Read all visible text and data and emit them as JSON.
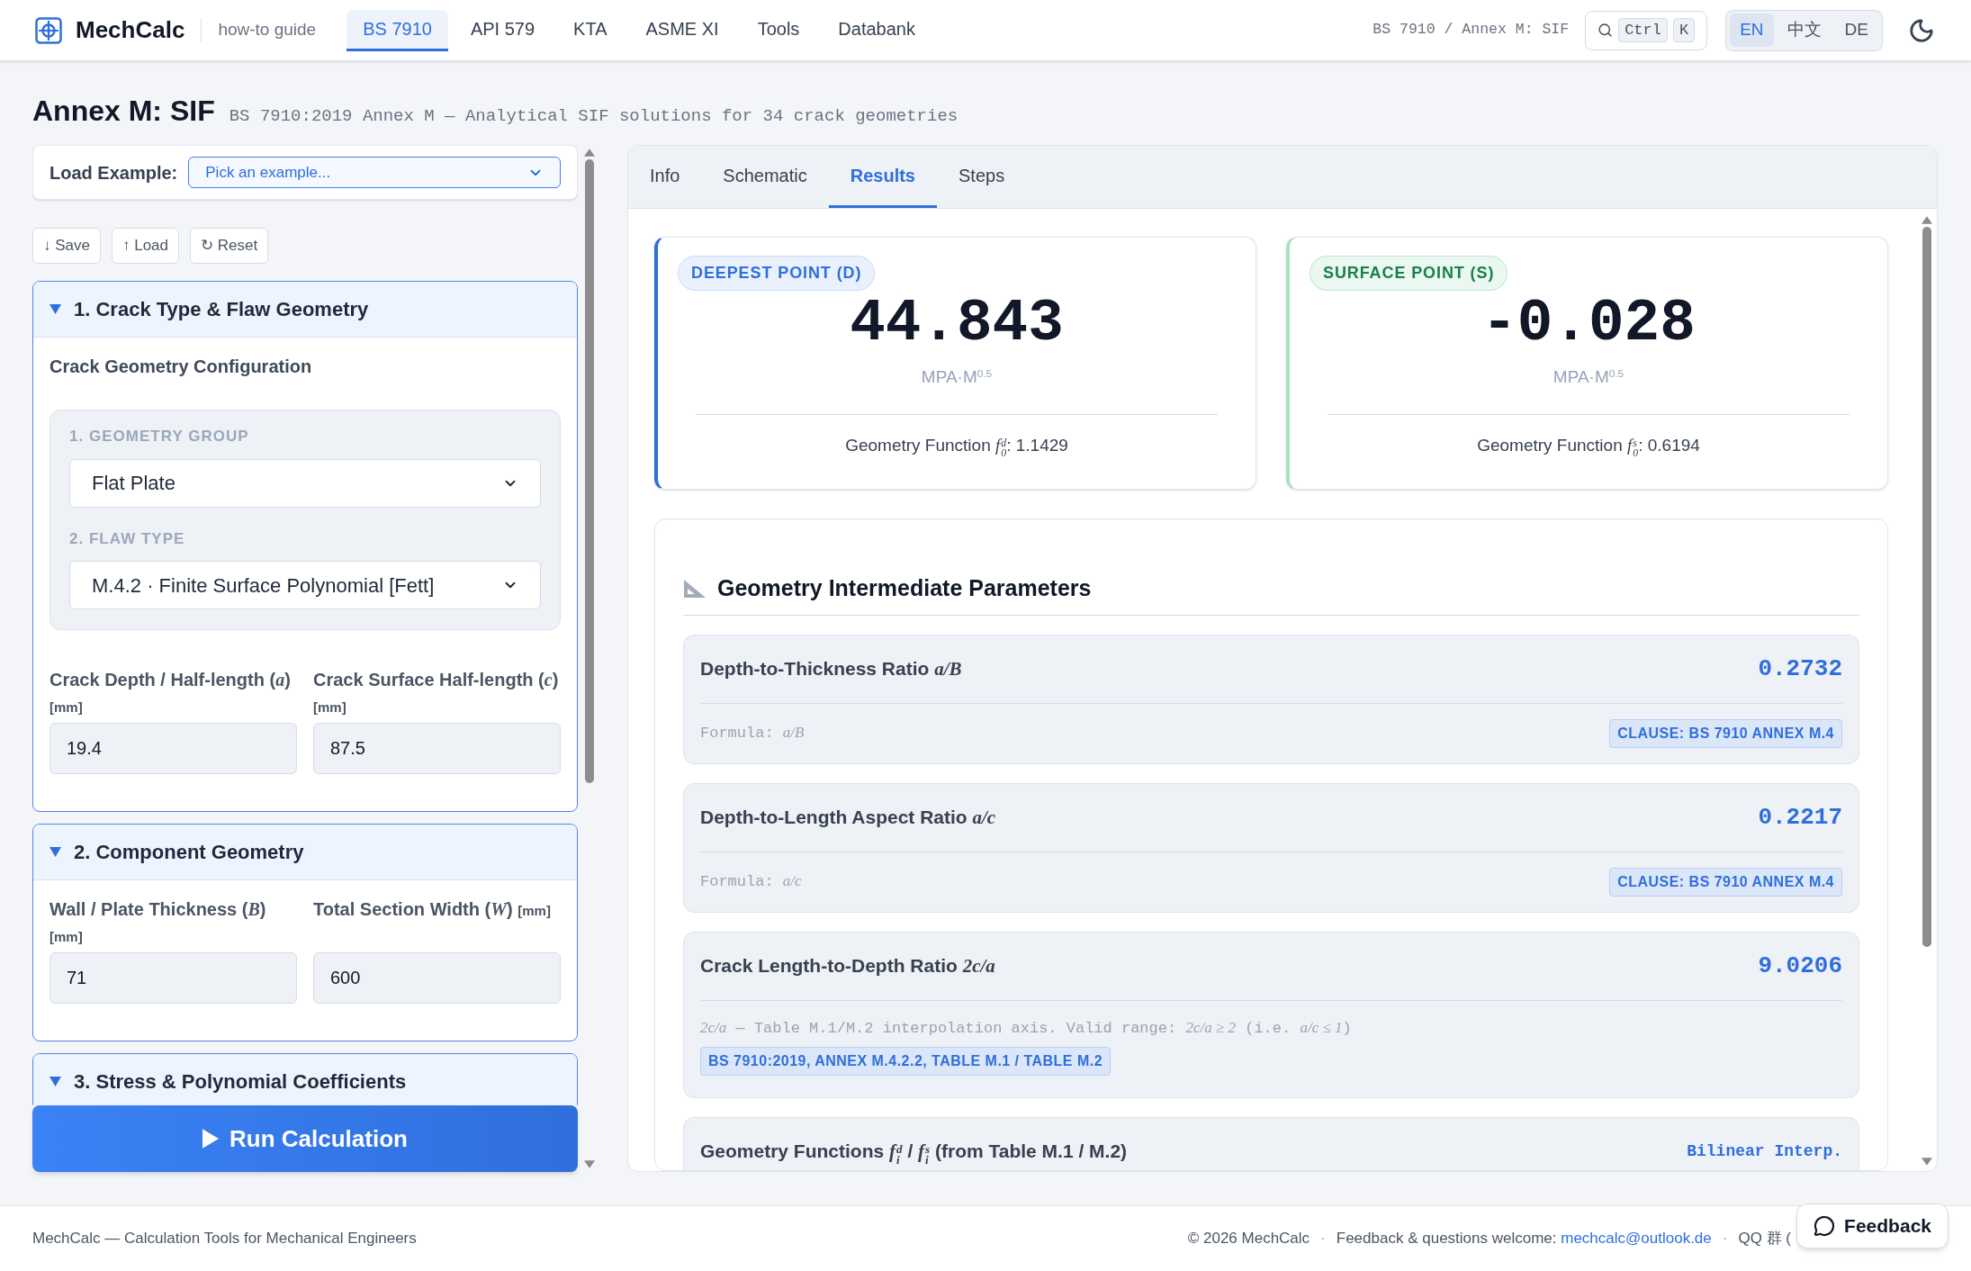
{
  "header": {
    "brand": "MechCalc",
    "guide_link": "how-to guide",
    "nav": [
      {
        "label": "BS 7910",
        "selected": true
      },
      {
        "label": "API 579",
        "selected": false
      },
      {
        "label": "KTA",
        "selected": false
      },
      {
        "label": "ASME XI",
        "selected": false
      },
      {
        "label": "Tools",
        "selected": false
      },
      {
        "label": "Databank",
        "selected": false
      }
    ],
    "breadcrumb": "BS 7910 / Annex M: SIF",
    "search_keys": [
      "Ctrl",
      "K"
    ],
    "languages": [
      {
        "label": "EN",
        "selected": true
      },
      {
        "label": "中文",
        "selected": false
      },
      {
        "label": "DE",
        "selected": false
      }
    ]
  },
  "page": {
    "title": "Annex M: SIF",
    "subtitle": "BS 7910:2019 Annex M — Analytical SIF solutions for 34 crack geometries"
  },
  "left_panel": {
    "load_example": {
      "label": "Load Example:",
      "placeholder": "Pick an example..."
    },
    "actions": [
      "↓ Save",
      "↑ Load",
      "↻ Reset"
    ],
    "sections": [
      {
        "title": "1. Crack Type & Flaw Geometry",
        "expanded": true,
        "subtitle": "Crack Geometry Configuration",
        "selects": [
          {
            "label": "1. GEOMETRY GROUP",
            "value": "Flat Plate"
          },
          {
            "label": "2. FLAW TYPE",
            "value": "M.4.2 · Finite Surface Polynomial [Fett]"
          }
        ],
        "fields": [
          {
            "label": [
              {
                "text": "Crack Depth / Half-length ("
              },
              {
                "math": "a"
              },
              {
                "text": ")"
              }
            ],
            "unit": "[mm]",
            "value": "19.4"
          },
          {
            "label": [
              {
                "text": "Crack Surface Half-length ("
              },
              {
                "math": "c"
              },
              {
                "text": ")"
              }
            ],
            "unit": "[mm]",
            "value": "87.5"
          }
        ]
      },
      {
        "title": "2. Component Geometry",
        "expanded": true,
        "fields": [
          {
            "label": [
              {
                "text": "Wall / Plate Thickness ("
              },
              {
                "math": "B"
              },
              {
                "text": ")"
              }
            ],
            "unit": "[mm]",
            "value": "71"
          },
          {
            "label": [
              {
                "text": "Total Section Width ("
              },
              {
                "math": "W"
              },
              {
                "text": ")"
              }
            ],
            "unit": "[mm]",
            "value": "600"
          }
        ]
      },
      {
        "title": "3. Stress & Polynomial Coefficients",
        "expanded": true
      }
    ],
    "run_button": "Run Calculation"
  },
  "results_panel": {
    "tabs": [
      {
        "label": "Info",
        "selected": false
      },
      {
        "label": "Schematic",
        "selected": false
      },
      {
        "label": "Results",
        "selected": true
      },
      {
        "label": "Steps",
        "selected": false
      }
    ],
    "points": [
      {
        "kind": "deepest",
        "badge": "DEEPEST POINT (D)",
        "value": "44.843",
        "unit": [
          {
            "text": "MPA·M",
            "sup": "0.5"
          }
        ],
        "function": [
          {
            "text": "Geometry Function "
          },
          {
            "math": "f",
            "sub": "0",
            "sup": "d"
          },
          {
            "text": ": 1.1429"
          }
        ]
      },
      {
        "kind": "surface",
        "badge": "SURFACE POINT (S)",
        "value": "-0.028",
        "unit": [
          {
            "text": "MPA·M",
            "sup": "0.5"
          }
        ],
        "function": [
          {
            "text": "Geometry Function "
          },
          {
            "math": "f",
            "sub": "0",
            "sup": "s"
          },
          {
            "text": ": 0.6194"
          }
        ]
      }
    ],
    "parameters": {
      "title": "Geometry Intermediate Parameters",
      "rows": [
        {
          "kind": "formula",
          "title": [
            {
              "text": "Depth-to-Thickness Ratio "
            },
            {
              "math": "a/B"
            }
          ],
          "value": "0.2732",
          "formula": [
            {
              "text": "Formula: "
            },
            {
              "math": "a/B"
            }
          ],
          "clause": "CLAUSE: BS 7910 ANNEX M.4"
        },
        {
          "kind": "formula",
          "title": [
            {
              "text": "Depth-to-Length Aspect Ratio "
            },
            {
              "math": "a/c"
            }
          ],
          "value": "0.2217",
          "formula": [
            {
              "text": "Formula: "
            },
            {
              "math": "a/c"
            }
          ],
          "clause": "CLAUSE: BS 7910 ANNEX M.4"
        },
        {
          "kind": "note",
          "title": [
            {
              "text": "Crack Length-to-Depth Ratio "
            },
            {
              "math": "2c/a"
            }
          ],
          "value": "9.0206",
          "note": [
            {
              "math": "2c/a"
            },
            {
              "text": " — Table M.1/M.2 interpolation axis. Valid range: "
            },
            {
              "math": "2c/a ≥ 2"
            },
            {
              "text": " (i.e. "
            },
            {
              "math": "a/c ≤ 1"
            },
            {
              "text": ")"
            }
          ],
          "clause": "BS 7910:2019, ANNEX M.4.2.2, TABLE M.1 / TABLE M.2"
        },
        {
          "kind": "lookup",
          "title": [
            {
              "text": "Geometry Functions "
            },
            {
              "math": "f",
              "sub": "i",
              "sup": "d"
            },
            {
              "text": " / "
            },
            {
              "math": "f",
              "sub": "i",
              "sup": "s"
            },
            {
              "text": " (from Table M.1 / M.2)"
            }
          ],
          "value": "Bilinear Interp."
        }
      ]
    }
  },
  "footer": {
    "left": "MechCalc — Calculation Tools for Mechanical Engineers",
    "right": [
      {
        "kind": "text",
        "text": "© 2026 MechCalc"
      },
      {
        "kind": "separator",
        "text": "·"
      },
      {
        "kind": "contact",
        "text": "Feedback & questions welcome: ",
        "link": "mechcalc@outlook.de"
      },
      {
        "kind": "separator",
        "text": "·"
      },
      {
        "kind": "text",
        "text": "QQ 群 ("
      }
    ]
  },
  "feedback_button": "Feedback"
}
